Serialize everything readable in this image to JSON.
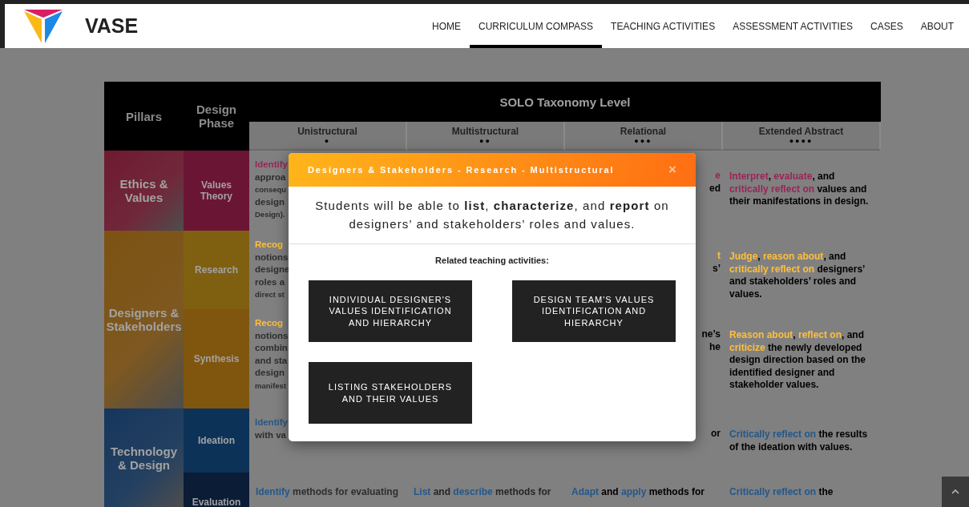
{
  "header": {
    "logo_text": "VASE",
    "nav": [
      {
        "label": "HOME",
        "selected": false
      },
      {
        "label": "CURRICULUM COMPASS",
        "selected": true
      },
      {
        "label": "TEACHING ACTIVITIES",
        "selected": false
      },
      {
        "label": "ASSESSMENT ACTIVITIES",
        "selected": false
      },
      {
        "label": "CASES",
        "selected": false
      },
      {
        "label": "ABOUT",
        "selected": false
      }
    ]
  },
  "table": {
    "pillars_heading": "Pillars",
    "phase_heading": "Design Phase",
    "solo_heading": "SOLO Taxonomy Level",
    "levels": [
      {
        "name": "Unistructural",
        "dots": "●"
      },
      {
        "name": "Multistructural",
        "dots": "●●"
      },
      {
        "name": "Relational",
        "dots": "●●●"
      },
      {
        "name": "Extended Abstract",
        "dots": "●●●●"
      }
    ],
    "pillars": [
      {
        "label": "Ethics & Values",
        "color": "#6e1a30",
        "phases": [
          {
            "label": "Values Theory",
            "color": "#6b1535",
            "cells": [
              {
                "kind": "fragments",
                "lines": [
                  {
                    "text": "Identify",
                    "color": "#9b2456",
                    "small": false
                  },
                  {
                    "text": "approa",
                    "small": false
                  },
                  {
                    "text": "consequ",
                    "small": true
                  },
                  {
                    "text": "design",
                    "small": false
                  },
                  {
                    "text": "Design).",
                    "small": true
                  }
                ]
              },
              null,
              {
                "kind": "edge",
                "lines": [
                  {
                    "text": "e",
                    "color": "#9b2456",
                    "small": false
                  },
                  {
                    "text": "ed",
                    "small": false
                  }
                ]
              },
              {
                "kind": "text",
                "segments": [
                  {
                    "text": "Interpret",
                    "color": "#9b2456"
                  },
                  {
                    "text": ", "
                  },
                  {
                    "text": "evaluate",
                    "color": "#9b2456"
                  },
                  {
                    "text": ", and "
                  },
                  {
                    "text": "critically reflect on",
                    "color": "#9b2456"
                  },
                  {
                    "text": " values and their manifestations in design."
                  }
                ]
              }
            ]
          }
        ]
      },
      {
        "label": "Designers & Stakeholders",
        "color": "#7d5212",
        "phases": [
          {
            "label": "Research",
            "color": "#7f6011",
            "cells": [
              {
                "kind": "fragments",
                "lines": [
                  {
                    "text": "Recog",
                    "color": "#ffbf3a",
                    "small": false
                  },
                  {
                    "text": "notions",
                    "small": false
                  },
                  {
                    "text": "designe",
                    "small": false
                  },
                  {
                    "text": "roles a",
                    "small": false
                  },
                  {
                    "text": "direct st",
                    "small": true
                  }
                ]
              },
              null,
              {
                "kind": "edge",
                "lines": [
                  {
                    "text": "t",
                    "color": "#ffbf3a",
                    "small": false
                  },
                  {
                    "text": "s’",
                    "small": false
                  }
                ]
              },
              {
                "kind": "text",
                "segments": [
                  {
                    "text": "Judge",
                    "color": "#ffbf3a"
                  },
                  {
                    "text": ", "
                  },
                  {
                    "text": "reason about",
                    "color": "#ffbf3a"
                  },
                  {
                    "text": ", and "
                  },
                  {
                    "text": "critically reflect on",
                    "color": "#ffbf3a"
                  },
                  {
                    "text": " designers’ and stakeholders’ roles and values."
                  }
                ]
              }
            ]
          },
          {
            "label": "Synthesis",
            "color": "#80560f",
            "cells": [
              {
                "kind": "fragments",
                "lines": [
                  {
                    "text": "Recog",
                    "color": "#ffbf3a",
                    "small": false
                  },
                  {
                    "text": "notions",
                    "small": false
                  },
                  {
                    "text": "combin",
                    "small": false
                  },
                  {
                    "text": "and sta",
                    "small": false
                  },
                  {
                    "text": "design",
                    "small": false
                  },
                  {
                    "text": "manifest",
                    "small": true
                  }
                ]
              },
              null,
              {
                "kind": "edge",
                "lines": [
                  {
                    "text": "ne’s",
                    "small": false
                  },
                  {
                    "text": "he",
                    "small": false
                  }
                ]
              },
              {
                "kind": "text",
                "segments": [
                  {
                    "text": "Reason about",
                    "color": "#ffbf3a"
                  },
                  {
                    "text": ", "
                  },
                  {
                    "text": "reflect on",
                    "color": "#ffbf3a"
                  },
                  {
                    "text": ", and "
                  },
                  {
                    "text": "criticize",
                    "color": "#ffbf3a"
                  },
                  {
                    "text": " the newly developed design direction based on the identified designer and stakeholder values."
                  }
                ]
              }
            ]
          }
        ]
      },
      {
        "label": "Technology & Design",
        "color": "#15365c",
        "phases": [
          {
            "label": "Ideation",
            "color": "#0d3258",
            "cells": [
              {
                "kind": "fragments",
                "lines": [
                  {
                    "text": "Identify",
                    "color": "#24578a",
                    "small": false
                  },
                  {
                    "text": "with va",
                    "small": false
                  }
                ]
              },
              null,
              {
                "kind": "edge",
                "lines": [
                  {
                    "text": "or",
                    "small": false
                  }
                ]
              },
              {
                "kind": "text",
                "segments": [
                  {
                    "text": "Critically reflect on",
                    "color": "#24578a"
                  },
                  {
                    "text": " the results of the ideation with values."
                  }
                ]
              }
            ]
          },
          {
            "label": "Evaluation",
            "color": "#0b1c36",
            "cells": [
              {
                "kind": "line",
                "segments": [
                  {
                    "text": "Identify",
                    "color": "#24578a"
                  },
                  {
                    "text": " methods for evaluating"
                  }
                ]
              },
              {
                "kind": "line",
                "segments": [
                  {
                    "text": "List",
                    "color": "#24578a"
                  },
                  {
                    "text": " and "
                  },
                  {
                    "text": "describe",
                    "color": "#24578a"
                  },
                  {
                    "text": " methods for"
                  }
                ]
              },
              {
                "kind": "line",
                "segments": [
                  {
                    "text": "Adapt",
                    "color": "#24578a"
                  },
                  {
                    "text": " and "
                  },
                  {
                    "text": "apply",
                    "color": "#24578a"
                  },
                  {
                    "text": " methods for"
                  }
                ]
              },
              {
                "kind": "line",
                "segments": [
                  {
                    "text": "Critically reflect on",
                    "color": "#24578a"
                  },
                  {
                    "text": " the"
                  }
                ]
              }
            ]
          }
        ]
      }
    ]
  },
  "modal": {
    "title": "Designers & Stakeholders - Research - Multistructural",
    "close": "×",
    "statement": "Students will be able to **list**, **characterize**, and **report** on designers’ and stakeholders’ roles and values.",
    "related_heading": "Related teaching activities:",
    "activities": [
      "INDIVIDUAL DESIGNER'S VALUES IDENTIFICATION AND HIERARCHY",
      "DESIGN TEAM'S VALUES IDENTIFICATION AND HIERARCHY",
      "LISTING STAKEHOLDERS AND THEIR VALUES"
    ]
  }
}
